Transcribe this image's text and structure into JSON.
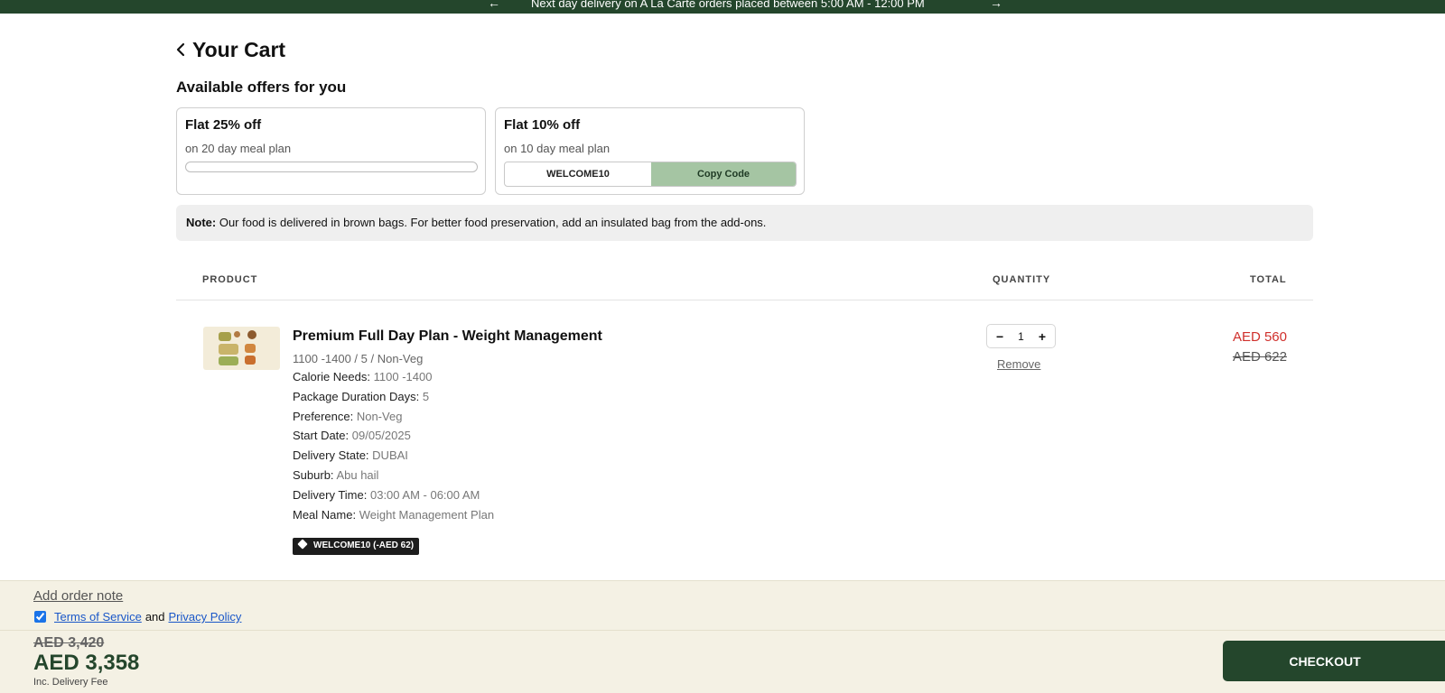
{
  "announcement": {
    "text": "Next day delivery on A La Carte orders placed between 5:00 AM - 12:00 PM",
    "prev_arrow": "←",
    "next_arrow": "→"
  },
  "header": {
    "title": "Your Cart",
    "back_icon": "chevron-left-icon"
  },
  "offers": {
    "title": "Available offers for you",
    "items": [
      {
        "title": "Flat 25% off",
        "subtitle": "on 20 day meal plan"
      },
      {
        "title": "Flat 10% off",
        "subtitle": "on 10 day meal plan",
        "code": "WELCOME10",
        "copy_label": "Copy Code"
      }
    ]
  },
  "note": {
    "label": "Note:",
    "text": " Our food is delivered in brown bags. For better food preservation, add an insulated bag from the add-ons."
  },
  "table": {
    "headers": [
      "PRODUCT",
      "QUANTITY",
      "TOTAL"
    ]
  },
  "item": {
    "name": "Premium Full Day Plan - Weight Management",
    "variant": "1100 -1400 / 5 / Non-Veg",
    "properties": [
      {
        "label": "Calorie Needs:",
        "value": "1100 -1400"
      },
      {
        "label": "Package Duration Days:",
        "value": "5"
      },
      {
        "label": "Preference:",
        "value": "Non-Veg"
      },
      {
        "label": "Start Date:",
        "value": "09/05/2025"
      },
      {
        "label": "Delivery State:",
        "value": "DUBAI"
      },
      {
        "label": "Suburb:",
        "value": "Abu hail"
      },
      {
        "label": "Delivery Time:",
        "value": "03:00 AM - 06:00 AM"
      },
      {
        "label": "Meal Name:",
        "value": "Weight Management Plan"
      }
    ],
    "coupon": "WELCOME10 (-AED 62)",
    "quantity": "1",
    "minus": "−",
    "plus": "+",
    "remove_label": "Remove",
    "price": "AED 560",
    "compare_price": "AED 622"
  },
  "footer": {
    "order_note_label": "Add order note",
    "terms_label": "Terms of Service",
    "and_label": "and",
    "privacy_label": "Privacy Policy",
    "terms_checked": true,
    "compare_total": "AED 3,420",
    "total": "AED 3,358",
    "fee_note": "Inc. Delivery Fee",
    "checkout_label": "CHECKOUT"
  },
  "colors": {
    "brand": "#24462c",
    "accent": "#a5c5a3",
    "sale": "#d0302c",
    "footer_bg": "#f4f1e4"
  }
}
